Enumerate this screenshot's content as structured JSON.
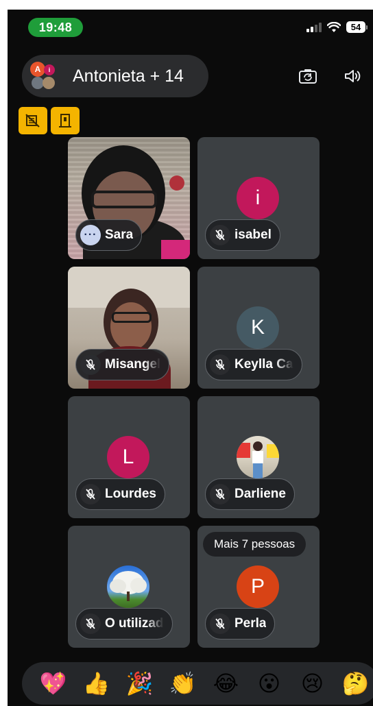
{
  "status_bar": {
    "time": "19:48",
    "battery": "54"
  },
  "header": {
    "title": "Antonieta + 14",
    "avatar_letters": [
      "A",
      "i"
    ]
  },
  "participants": [
    {
      "name": "Sara",
      "type": "video",
      "indicator": "more-options"
    },
    {
      "name": "isabel",
      "type": "initial",
      "initial": "i",
      "color": "#c2185b",
      "muted": true
    },
    {
      "name": "Misangel",
      "type": "video",
      "muted": true
    },
    {
      "name": "Keylla Ca",
      "type": "initial",
      "initial": "K",
      "color": "#455a64",
      "muted": true
    },
    {
      "name": "Lourdes",
      "type": "initial",
      "initial": "L",
      "color": "#c2185b",
      "muted": true
    },
    {
      "name": "Darliene",
      "type": "photo",
      "muted": true
    },
    {
      "name": "O utilizad",
      "type": "photo",
      "muted": true
    },
    {
      "name": "Perla",
      "type": "initial",
      "initial": "P",
      "color": "#d84315",
      "muted": true
    }
  ],
  "more_people": "Mais 7 pessoas",
  "reactions": [
    "💖",
    "👍",
    "🎉",
    "👏",
    "😂",
    "😮",
    "😢",
    "🤔"
  ],
  "colors": {
    "background": "#0b0b0b",
    "tile": "#3c4043",
    "time_pill": "#1f9d3a",
    "badge": "#f4b400"
  }
}
